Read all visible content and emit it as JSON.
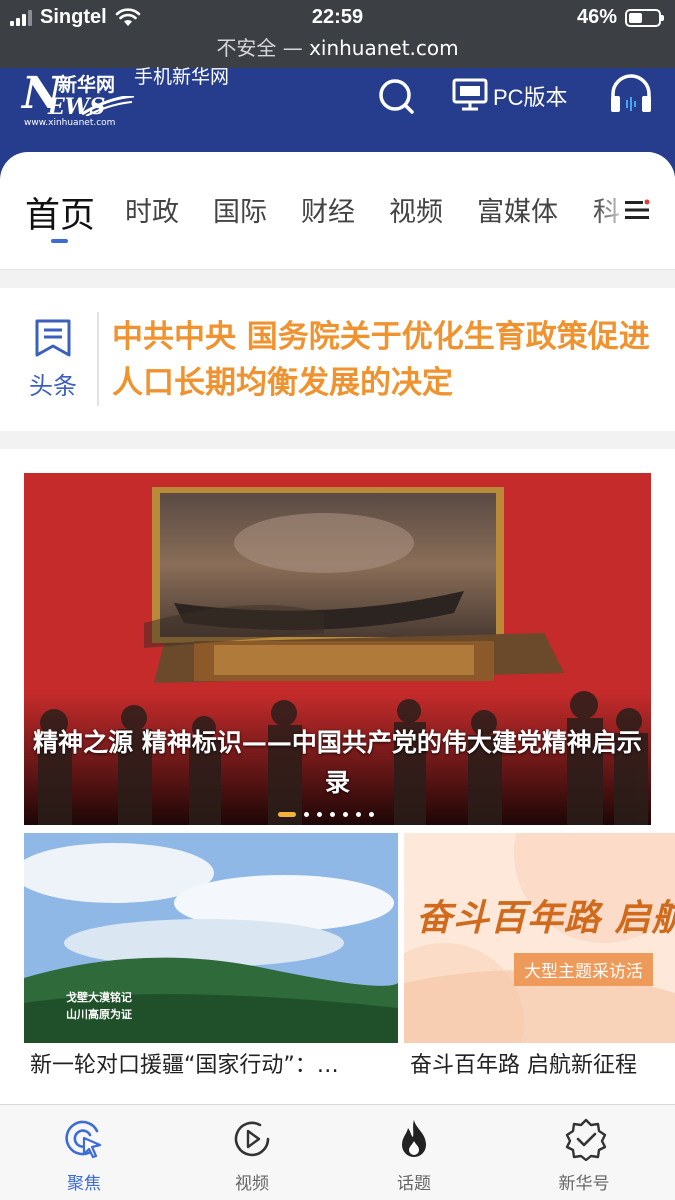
{
  "status_bar": {
    "carrier": "Singtel",
    "time": "22:59",
    "battery_percent": "46%",
    "battery_level": 0.46
  },
  "url_bar": {
    "security": "不安全 —",
    "domain": "xinhuanet.com"
  },
  "header": {
    "logo_cn": "新华网",
    "logo_en_big": "N",
    "logo_en_rest": "EWS",
    "logo_url": "www.xinhuanet.com",
    "site_name": "手机新华网",
    "pc_version": "PC版本",
    "search_icon": "search-icon",
    "pc_icon": "monitor-icon",
    "audio_icon": "headphones-icon",
    "brand_color": "#253d8c"
  },
  "tabs": {
    "items": [
      "首页",
      "时政",
      "国际",
      "财经",
      "视频",
      "富媒体",
      "科"
    ],
    "active": "首页",
    "accent_color": "#3d6cd6"
  },
  "headline": {
    "label": "头条",
    "text": "中共中央 国务院关于优化生育政策促进人口长期均衡发展的决定",
    "color": "#f0922e"
  },
  "feed": {
    "hero": {
      "caption": "精神之源 精神标识——中国共产党的伟大建党精神启示录",
      "slide_count": 7,
      "active_slide": 1
    },
    "cards": [
      {
        "title": "新一轮对口援疆“国家行动”：…",
        "image_text_1": "戈壁大漠铭记",
        "image_text_2": "山川高原为证"
      },
      {
        "title": "奋斗百年路 启航新征程",
        "image_text_1": "奋斗百年路 启航",
        "image_text_2": "大型主题采访活"
      }
    ]
  },
  "bottom_nav": {
    "items": [
      {
        "label": "聚焦",
        "icon": "focus-icon",
        "active": true
      },
      {
        "label": "视频",
        "icon": "play-icon",
        "active": false
      },
      {
        "label": "话题",
        "icon": "flame-icon",
        "active": false
      },
      {
        "label": "新华号",
        "icon": "badge-check-icon",
        "active": false
      }
    ]
  }
}
